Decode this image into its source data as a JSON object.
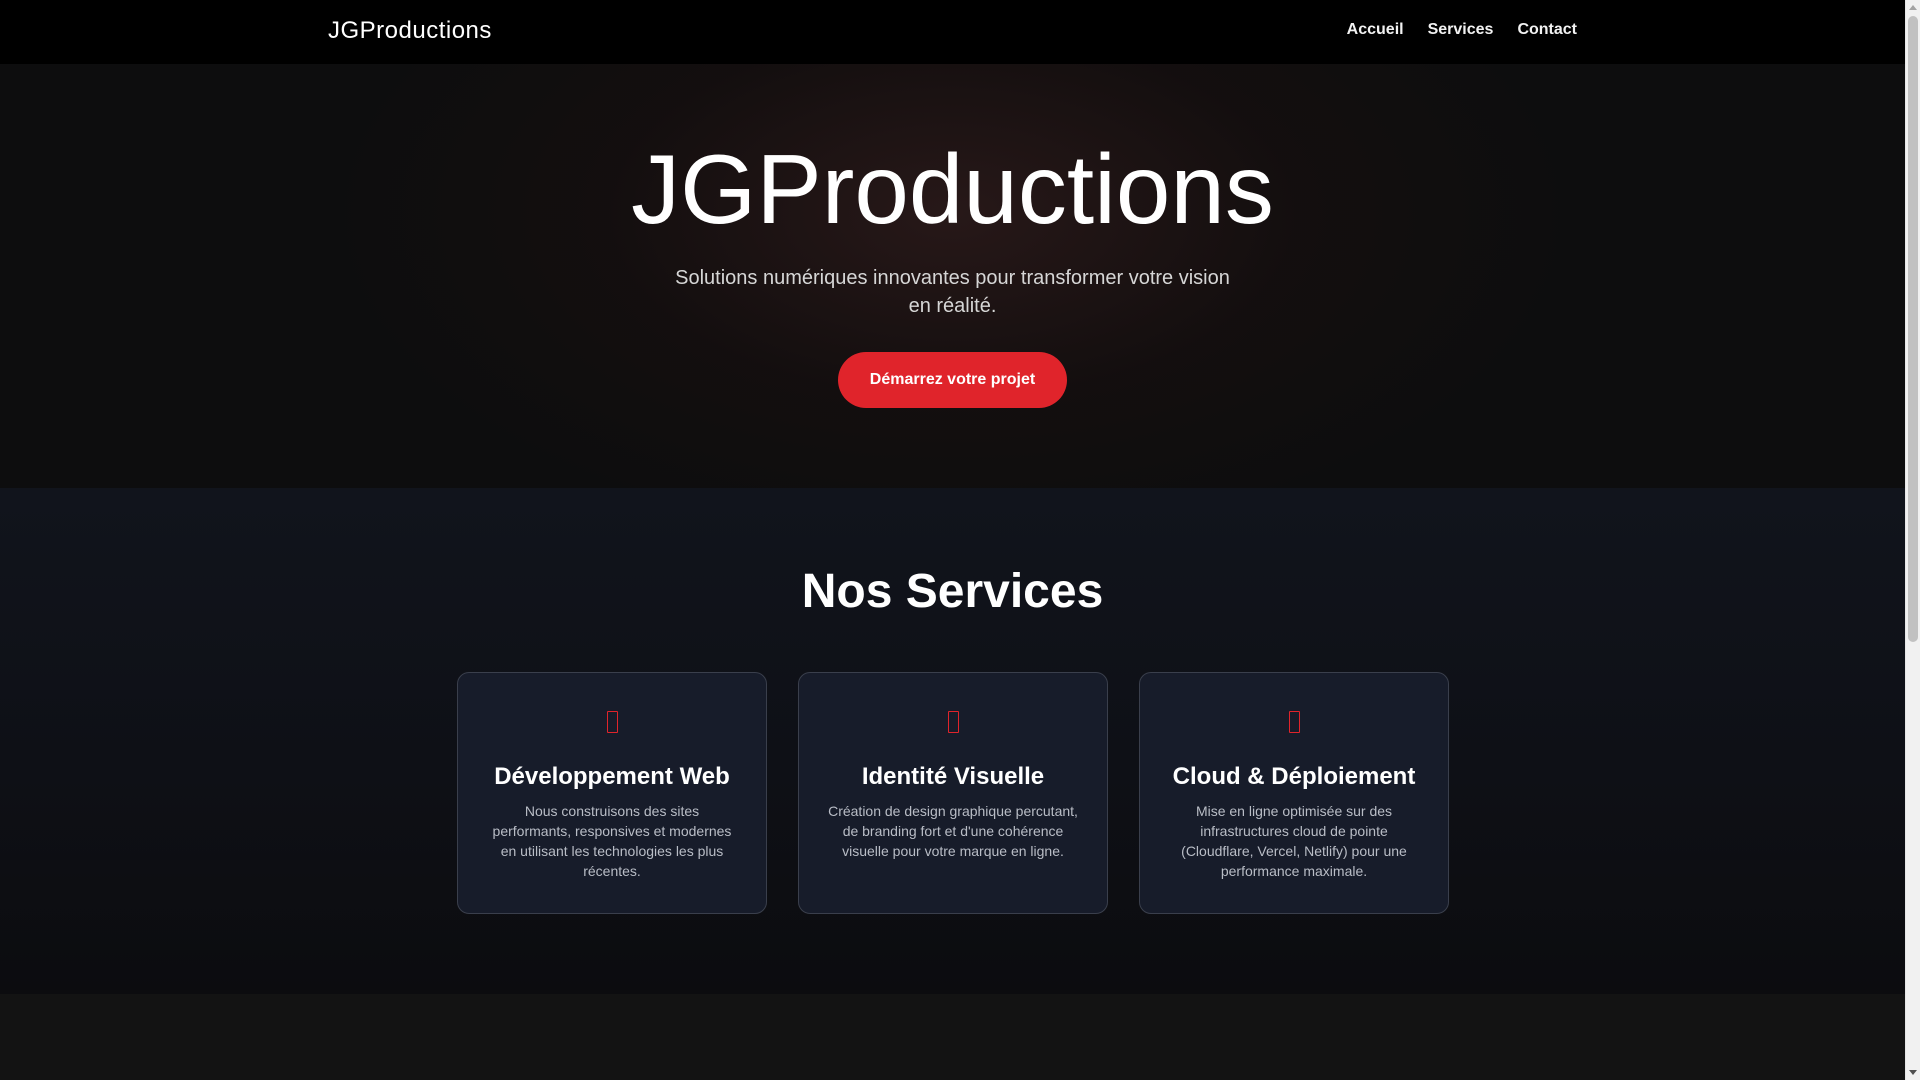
{
  "header": {
    "brand": "JGProductions",
    "nav": [
      {
        "label": "Accueil"
      },
      {
        "label": "Services"
      },
      {
        "label": "Contact"
      }
    ]
  },
  "hero": {
    "title": "JGProductions",
    "subtitle": "Solutions numériques innovantes pour transformer votre vision en réalité.",
    "cta_label": "Démarrez votre projet"
  },
  "services": {
    "title": "Nos Services",
    "cards": [
      {
        "icon": "missing-glyph-icon",
        "title": "Développement Web",
        "text": "Nous construisons des sites performants, responsives et modernes en utilisant les technologies les plus récentes."
      },
      {
        "icon": "missing-glyph-icon",
        "title": "Identité Visuelle",
        "text": "Création de design graphique percutant, de branding fort et d'une cohérence visuelle pour votre marque en ligne."
      },
      {
        "icon": "missing-glyph-icon",
        "title": "Cloud & Déploiement",
        "text": "Mise en ligne optimisée sur des infrastructures cloud de pointe (Cloudflare, Vercel, Netlify) pour une performance maximale."
      }
    ]
  },
  "colors": {
    "accent": "#e0242b",
    "header_bg": "#000000",
    "card_bg": "#171c2a"
  }
}
